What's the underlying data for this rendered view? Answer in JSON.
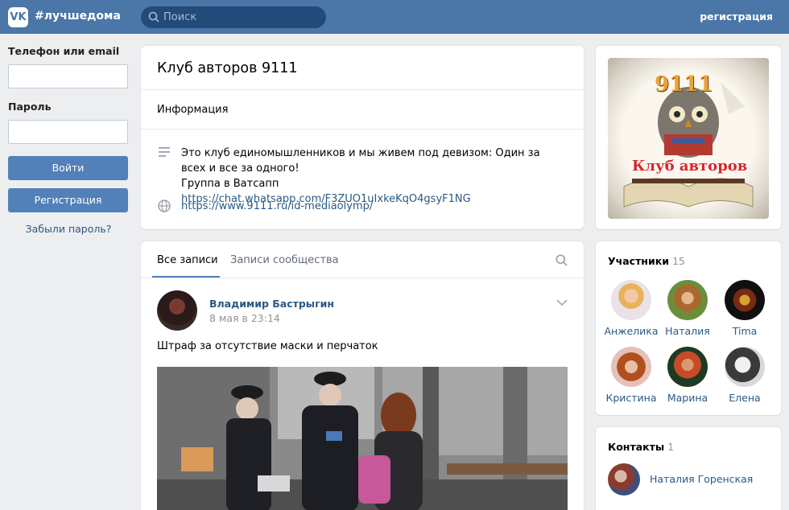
{
  "header": {
    "logo": "VK",
    "hashtag": "#лучшедома",
    "search_placeholder": "Поиск",
    "register_link": "регистрация"
  },
  "login": {
    "phone_label": "Телефон или email",
    "password_label": "Пароль",
    "login_button": "Войти",
    "register_button": "Регистрация",
    "forgot_link": "Забыли пароль?"
  },
  "group": {
    "title": "Клуб авторов 9111",
    "info_heading": "Информация",
    "description_line1": "Это клуб единомышленников и мы живем под девизом: Один за всех и все за одного!",
    "description_line2_prefix": "Группа в Ватсапп ",
    "whatsapp_link": "https://chat.whatsapp.com/F3ZUO1uIxkeKqO4gsyF1NG",
    "website": "https://www.9111.ru/id-mediaolymp/"
  },
  "wall": {
    "tabs": [
      "Все записи",
      "Записи сообщества"
    ],
    "post": {
      "author": "Владимир Бастрыгин",
      "date": "8 мая в 23:14",
      "text": "Штраф за отсутствие маски и перчаток"
    }
  },
  "cover": {
    "number": "9111",
    "title": "Клуб авторов"
  },
  "members": {
    "title": "Участники",
    "count": "15",
    "items": [
      {
        "name": "Анжелика"
      },
      {
        "name": "Наталия"
      },
      {
        "name": "Tima"
      },
      {
        "name": "Кристина"
      },
      {
        "name": "Марина"
      },
      {
        "name": "Елена"
      }
    ]
  },
  "contacts": {
    "title": "Контакты",
    "count": "1",
    "name": "Наталия Горенская"
  },
  "colors": {
    "header": "#4a76a8",
    "button": "#5181b8",
    "link": "#2a5885",
    "background": "#edeef0"
  }
}
